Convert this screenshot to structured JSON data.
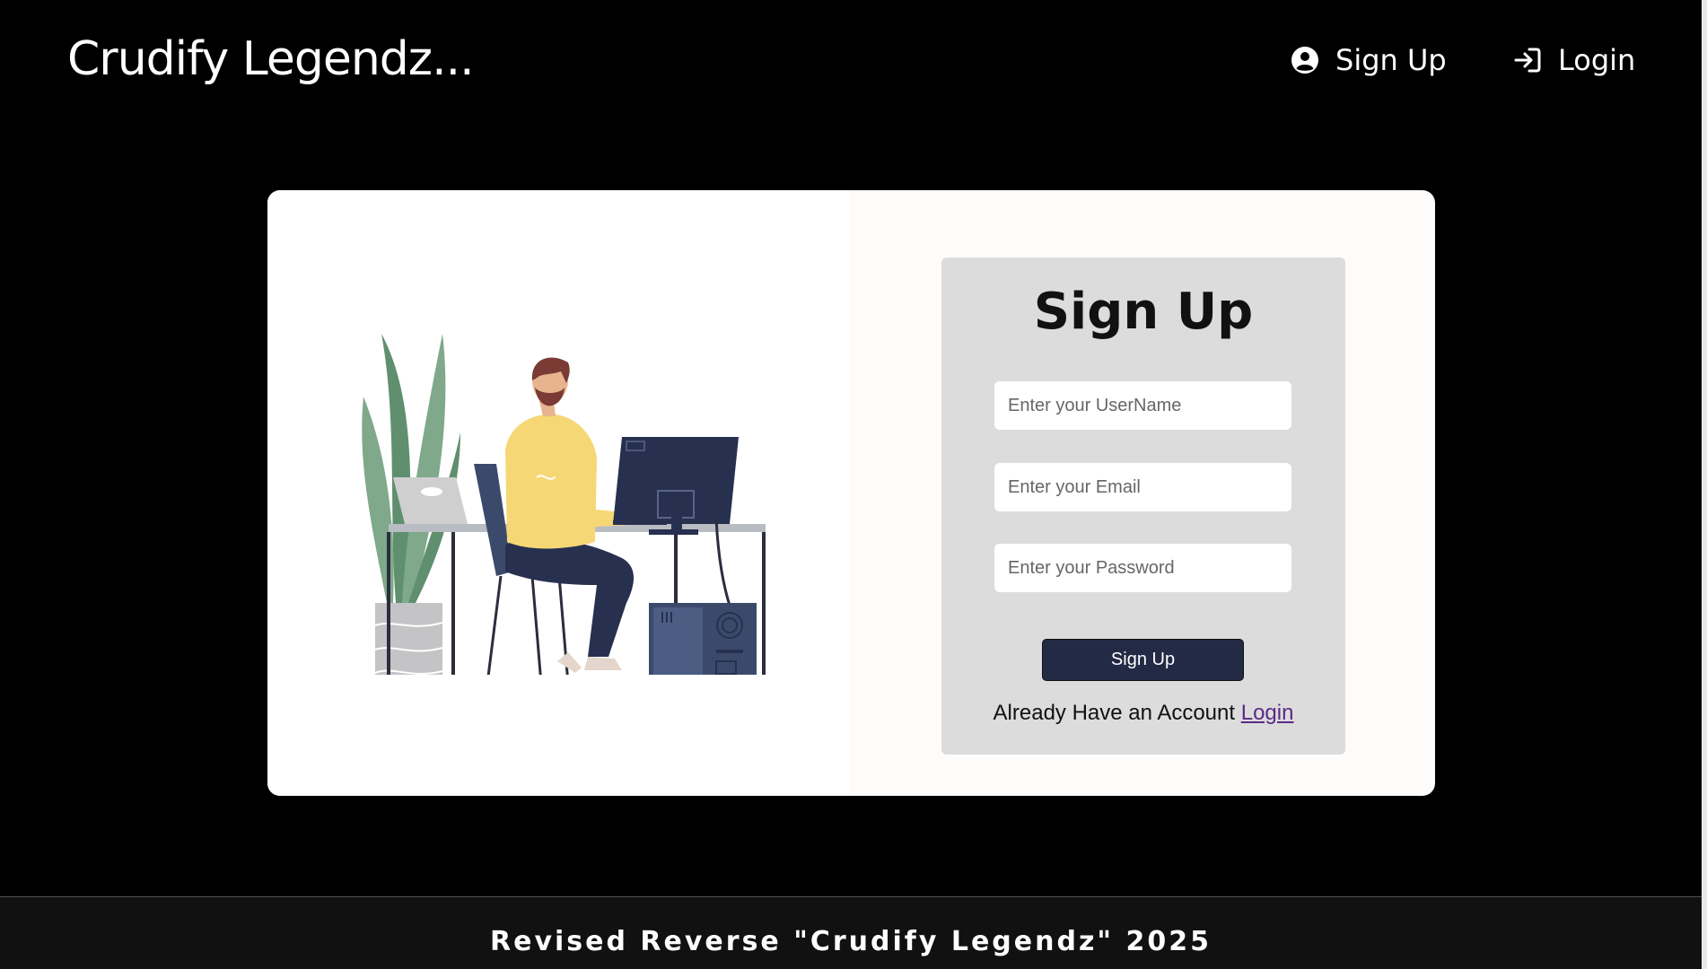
{
  "navbar": {
    "brand": "Crudify Legendz...",
    "signup_label": "Sign Up",
    "login_label": "Login",
    "signup_icon": "user-circle-icon",
    "login_icon": "login-arrow-icon"
  },
  "form": {
    "title": "Sign Up",
    "username_placeholder": "Enter your UserName",
    "email_placeholder": "Enter your Email",
    "password_placeholder": "Enter your Password",
    "submit_label": "Sign Up",
    "already_text": "Already Have an Account",
    "login_link": "Login"
  },
  "footer": {
    "text": "Revised Reverse \"Crudify Legendz\" 2025"
  },
  "colors": {
    "background": "#000000",
    "card": "#fdfcfa",
    "panel": "#dcdcdc",
    "button": "#232a45",
    "link": "#5b2a86"
  }
}
